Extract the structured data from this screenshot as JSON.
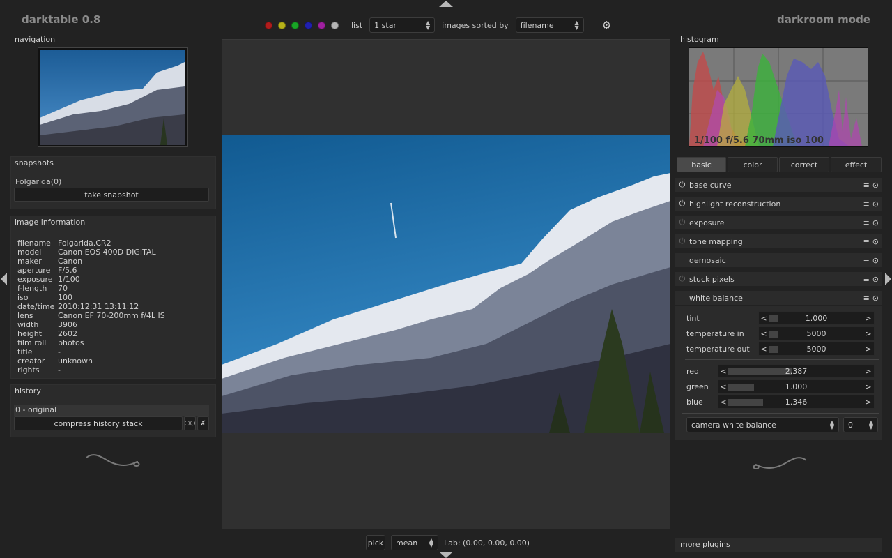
{
  "app": {
    "title": "darktable 0.8",
    "mode": "darkroom mode"
  },
  "topbar": {
    "color_labels": [
      {
        "name": "red",
        "color": "#b01c1c"
      },
      {
        "name": "yellow",
        "color": "#b7b219"
      },
      {
        "name": "green",
        "color": "#19a526"
      },
      {
        "name": "blue",
        "color": "#2020b0"
      },
      {
        "name": "magenta",
        "color": "#a020a0"
      },
      {
        "name": "gray",
        "color": "#b5b5b5"
      }
    ],
    "list_label": "list",
    "list_value": "1 star",
    "sort_label": "images sorted by",
    "sort_value": "filename",
    "settings_icon": "gear-icon"
  },
  "left": {
    "navigation_title": "navigation",
    "snapshots_title": "snapshots",
    "snapshot_item": "Folgarida(0)",
    "take_snapshot_label": "take snapshot",
    "image_info_title": "image information",
    "image_info": [
      {
        "key": "filename",
        "value": "Folgarida.CR2"
      },
      {
        "key": "model",
        "value": "Canon EOS 400D DIGITAL"
      },
      {
        "key": "maker",
        "value": "Canon"
      },
      {
        "key": "aperture",
        "value": "F/5.6"
      },
      {
        "key": "exposure",
        "value": "1/100"
      },
      {
        "key": "f-length",
        "value": "70"
      },
      {
        "key": "iso",
        "value": "100"
      },
      {
        "key": "date/time",
        "value": "2010:12:31 13:11:12"
      },
      {
        "key": "lens",
        "value": "Canon EF 70-200mm f/4L IS"
      },
      {
        "key": "width",
        "value": "3906"
      },
      {
        "key": "height",
        "value": "2602"
      },
      {
        "key": "film roll",
        "value": "photos"
      },
      {
        "key": "title",
        "value": "-"
      },
      {
        "key": "creator",
        "value": "unknown"
      },
      {
        "key": "rights",
        "value": "-"
      }
    ],
    "history_title": "history",
    "history_item": "0 - original",
    "compress_label": "compress history stack"
  },
  "bottombar": {
    "pick_label": "pick",
    "mode_value": "mean",
    "lab_readout": "Lab: (0.00, 0.00, 0.00)"
  },
  "right": {
    "histogram_title": "histogram",
    "exif_summary": "1/100 f/5.6 70mm iso 100",
    "tabs": [
      "basic",
      "color",
      "correct",
      "effect"
    ],
    "plugins": [
      {
        "label": "base curve",
        "power": "on"
      },
      {
        "label": "highlight reconstruction",
        "power": "on"
      },
      {
        "label": "exposure",
        "power": "off"
      },
      {
        "label": "tone mapping",
        "power": "off"
      },
      {
        "label": "demosaic",
        "power": "none"
      },
      {
        "label": "stuck pixels",
        "power": "off"
      },
      {
        "label": "white balance",
        "power": "none"
      }
    ],
    "wb": {
      "tint": {
        "label": "tint",
        "value": "1.000",
        "level": 0.1
      },
      "temp_in": {
        "label": "temperature in",
        "value": "5000",
        "level": 0.1
      },
      "temp_out": {
        "label": "temperature out",
        "value": "5000",
        "level": 0.1
      },
      "red": {
        "label": "red",
        "value": "2.387",
        "level": 0.47
      },
      "green": {
        "label": "green",
        "value": "1.000",
        "level": 0.19
      },
      "blue": {
        "label": "blue",
        "value": "1.346",
        "level": 0.26
      },
      "preset": "camera white balance",
      "preset_number": "0"
    },
    "more_plugins": "more plugins"
  }
}
